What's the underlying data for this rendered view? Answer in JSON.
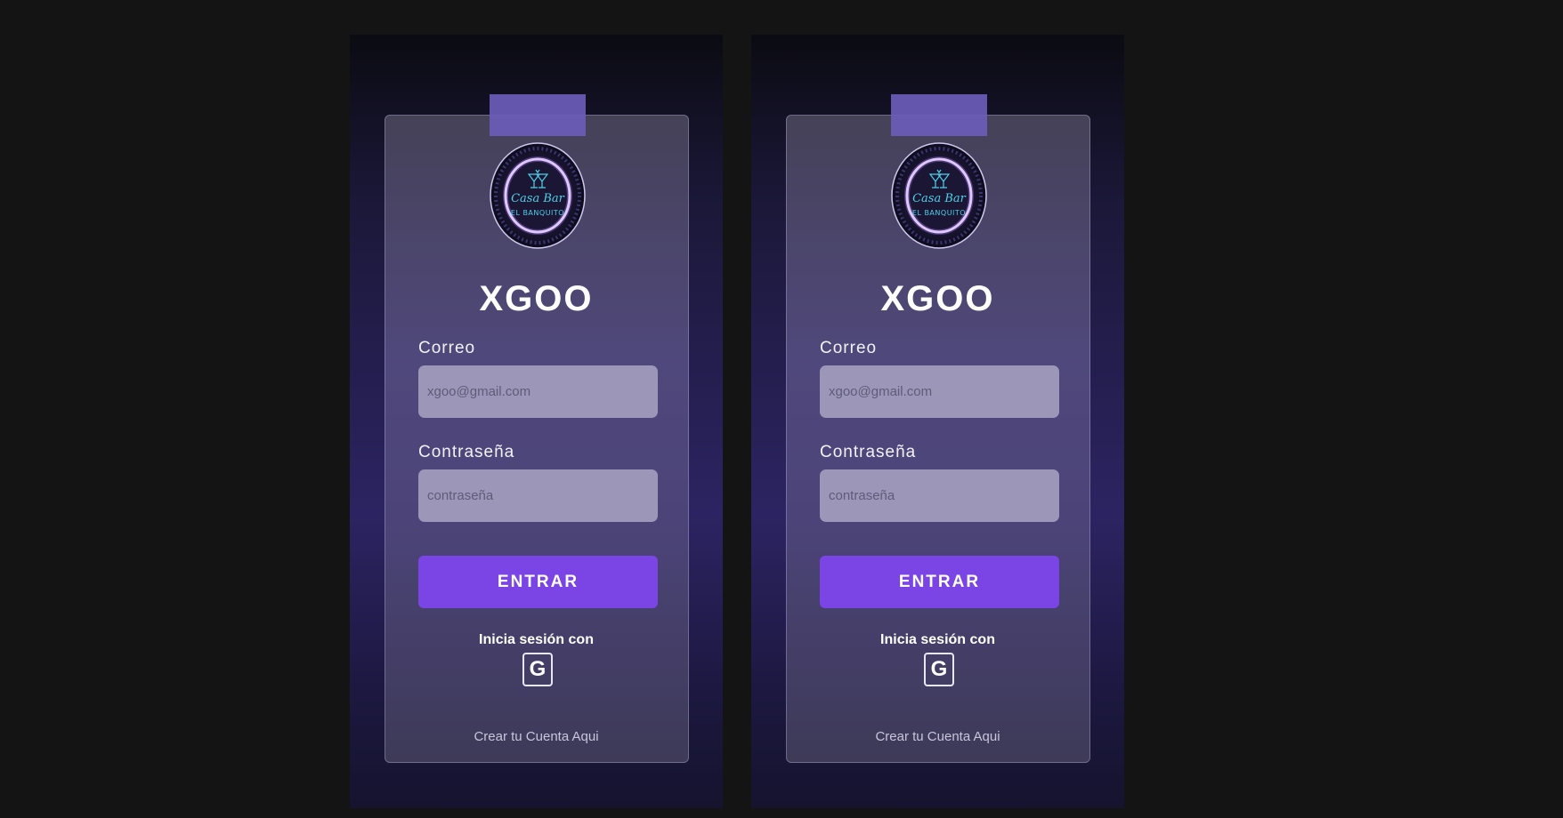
{
  "screens": [
    {
      "logo": {
        "line1": "Casa Bar",
        "line2": "EL BANQUITO",
        "icon": "martini-glasses-icon",
        "ring_color": "#c89bff",
        "text_color": "#4fd0e8"
      },
      "title": "XGOO",
      "email": {
        "label": "Correo",
        "placeholder": "xgoo@gmail.com"
      },
      "password": {
        "label": "Contraseña",
        "placeholder": "contraseña"
      },
      "submit_label": "ENTRAR",
      "social": {
        "text": "Inicia sesión con",
        "google_glyph": "G",
        "icon": "google-icon"
      },
      "create_account": "Crear tu Cuenta Aqui"
    },
    {
      "logo": {
        "line1": "Casa Bar",
        "line2": "EL BANQUITO",
        "icon": "martini-glasses-icon",
        "ring_color": "#c89bff",
        "text_color": "#4fd0e8"
      },
      "title": "XGOO",
      "email": {
        "label": "Correo",
        "placeholder": "xgoo@gmail.com"
      },
      "password": {
        "label": "Contraseña",
        "placeholder": "contraseña"
      },
      "submit_label": "ENTRAR",
      "social": {
        "text": "Inicia sesión con",
        "google_glyph": "G",
        "icon": "google-icon"
      },
      "create_account": "Crear tu Cuenta Aqui"
    }
  ],
  "colors": {
    "page_background": "#141414",
    "accent_button": "#7b45e6",
    "tape": "#6b5cb8",
    "input_background": "#9c97b8"
  }
}
